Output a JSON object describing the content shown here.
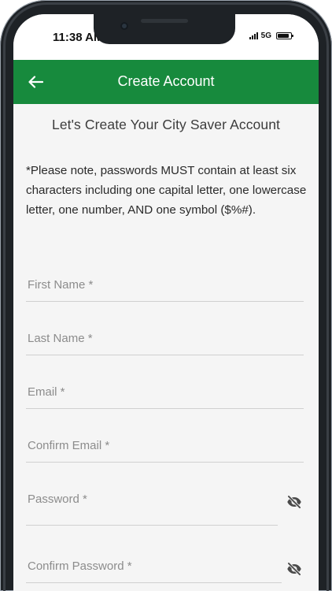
{
  "status_bar": {
    "time": "11:38 AM",
    "network": "5G",
    "icons": [
      "signal-icon",
      "battery-icon"
    ]
  },
  "app_bar": {
    "title": "Create Account",
    "back_icon": "back-arrow-icon",
    "color": "#178a3d"
  },
  "main": {
    "heading": "Let's Create Your City Saver Account",
    "password_note": "*Please note, passwords MUST contain at least six characters including one capital letter, one lowercase letter, one number, AND one symbol ($%#)."
  },
  "form": {
    "first_name": {
      "label": "First Name *",
      "value": ""
    },
    "last_name": {
      "label": "Last Name *",
      "value": ""
    },
    "email": {
      "label": "Email *",
      "value": ""
    },
    "confirm_email": {
      "label": "Confirm Email *",
      "value": ""
    },
    "password": {
      "label": "Password *",
      "value": "",
      "toggle_icon": "eye-off-icon"
    },
    "confirm_password": {
      "label": "Confirm Password *",
      "value": "",
      "toggle_icon": "eye-off-icon"
    }
  }
}
